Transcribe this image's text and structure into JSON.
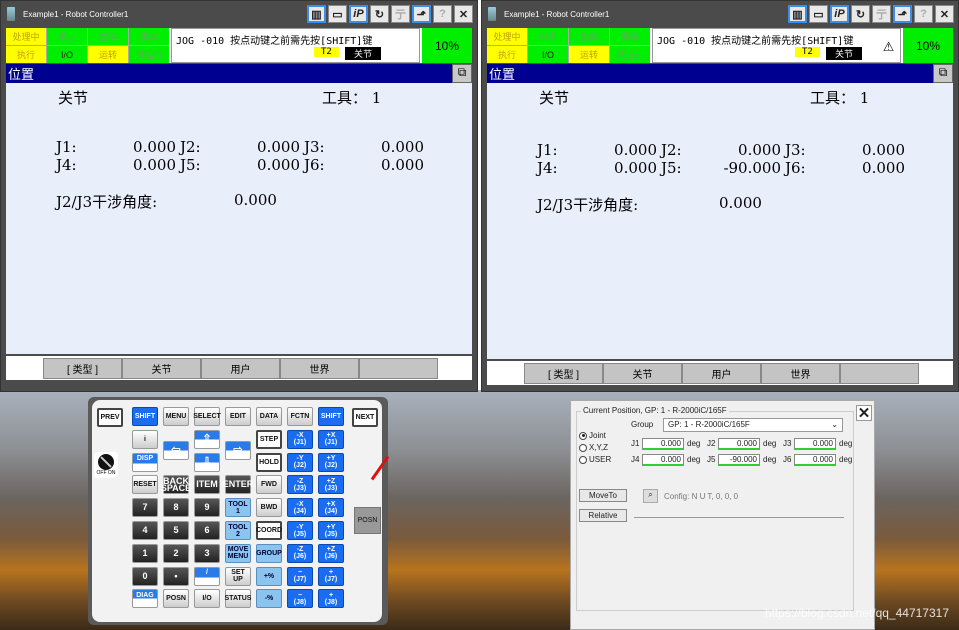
{
  "left": {
    "title": "Example1 - Robot Controller1",
    "toolbar_icons": [
      "trash-icon",
      "keyboard-icon",
      "ip-icon",
      "refresh-icon",
      "teach-icon",
      "export-icon",
      "help-icon",
      "close-icon"
    ],
    "leds": [
      "处理中",
      "单步",
      "暂停",
      "异常",
      "执行",
      "I/O",
      "运转",
      "试运行"
    ],
    "message": "JOG -010 按点动键之前需先按[SHIFT]键",
    "t2": "T2",
    "mode": "关节",
    "override": "10%",
    "screen_title": "位置",
    "coord_label": "关节",
    "tool_label": "工具： 1",
    "joints": [
      {
        "n": "J1:",
        "v": "0.000"
      },
      {
        "n": "J2:",
        "v": "0.000"
      },
      {
        "n": "J3:",
        "v": "0.000"
      },
      {
        "n": "J4:",
        "v": "0.000"
      },
      {
        "n": "J5:",
        "v": "0.000"
      },
      {
        "n": "J6:",
        "v": "0.000"
      }
    ],
    "interference_label": "J2/J3干涉角度:",
    "interference_value": "0.000",
    "function_keys": [
      "[ 类型 ]",
      "关节",
      "用户",
      "世界",
      ""
    ]
  },
  "right": {
    "title": "Example1 - Robot Controller1",
    "leds": [
      "处理中",
      "单步",
      "暂停",
      "异常",
      "执行",
      "I/O",
      "运转",
      "试运行"
    ],
    "message": "JOG -010 按点动键之前需先按[SHIFT]键",
    "t2": "T2",
    "mode": "关节",
    "override": "10%",
    "screen_title": "位置",
    "coord_label": "关节",
    "tool_label": "工具： 1",
    "joints": [
      {
        "n": "J1:",
        "v": "0.000"
      },
      {
        "n": "J2:",
        "v": "0.000"
      },
      {
        "n": "J3:",
        "v": "0.000"
      },
      {
        "n": "J4:",
        "v": "0.000"
      },
      {
        "n": "J5:",
        "v": "-90.000"
      },
      {
        "n": "J6:",
        "v": "0.000"
      }
    ],
    "interference_label": "J2/J3干涉角度:",
    "interference_value": "0.000",
    "function_keys": [
      "[ 类型 ]",
      "关节",
      "用户",
      "世界",
      ""
    ]
  },
  "keypad": {
    "prev": "PREV",
    "next": "NEXT",
    "side_posn": "POSN",
    "keyswitch": "OFF  ON",
    "rows": [
      [
        {
          "l": "SHIFT",
          "s": "blue"
        },
        {
          "l": "MENU",
          "s": "white"
        },
        {
          "l": "SELECT",
          "s": "white"
        },
        {
          "l": "EDIT",
          "s": "white"
        },
        {
          "l": "DATA",
          "s": "white"
        },
        {
          "l": "FCTN",
          "s": "white"
        },
        {
          "l": "SHIFT",
          "s": "blue"
        }
      ],
      [
        {
          "l": "i",
          "s": "white"
        },
        {
          "l": "⇦",
          "s": "arrow",
          "mid": true
        },
        {
          "l": "⇧",
          "s": "arrow"
        },
        {
          "l": "⇨",
          "s": "arrow",
          "mid": true
        },
        {
          "l": "STEP",
          "s": "boxed"
        },
        {
          "l": "-X\n(J1)",
          "s": "blue"
        },
        {
          "l": "+X\n(J1)",
          "s": "blue"
        }
      ],
      [
        {
          "l": "DISP\n▭▭",
          "s": "disp"
        },
        null,
        {
          "l": "⇩",
          "s": "arrow"
        },
        null,
        {
          "l": "HOLD",
          "s": "boxed"
        },
        {
          "l": "-Y\n(J2)",
          "s": "blue"
        },
        {
          "l": "+Y\n(J2)",
          "s": "blue"
        }
      ],
      [
        {
          "l": "RESET",
          "s": "white"
        },
        {
          "l": "BACK\nSPACE",
          "s": "dark"
        },
        {
          "l": "ITEM",
          "s": "dark"
        },
        {
          "l": "ENTER",
          "s": "dark"
        },
        {
          "l": "FWD",
          "s": "white"
        },
        {
          "l": "-Z\n(J3)",
          "s": "blue"
        },
        {
          "l": "+Z\n(J3)",
          "s": "blue"
        }
      ],
      [
        {
          "l": "7",
          "s": "dark"
        },
        {
          "l": "8",
          "s": "dark"
        },
        {
          "l": "9",
          "s": "dark"
        },
        {
          "l": "TOOL\n1",
          "s": "light"
        },
        {
          "l": "BWD",
          "s": "white"
        },
        {
          "l": "-X\n(J4)",
          "s": "blue"
        },
        {
          "l": "+X\n(J4)",
          "s": "blue"
        }
      ],
      [
        {
          "l": "4",
          "s": "dark"
        },
        {
          "l": "5",
          "s": "dark"
        },
        {
          "l": "6",
          "s": "dark"
        },
        {
          "l": "TOOL\n2",
          "s": "light"
        },
        {
          "l": "COORD",
          "s": "boxed"
        },
        {
          "l": "-Y\n(J5)",
          "s": "blue"
        },
        {
          "l": "+Y\n(J5)",
          "s": "blue"
        }
      ],
      [
        {
          "l": "1",
          "s": "dark"
        },
        {
          "l": "2",
          "s": "dark"
        },
        {
          "l": "3",
          "s": "dark"
        },
        {
          "l": "MOVE\nMENU",
          "s": "light"
        },
        {
          "l": "GROUP",
          "s": "light"
        },
        {
          "l": "-Z\n(J6)",
          "s": "blue"
        },
        {
          "l": "+Z\n(J6)",
          "s": "blue"
        }
      ],
      [
        {
          "l": "0",
          "s": "dark"
        },
        {
          "l": "•",
          "s": "dark"
        },
        {
          "l": "/\n—",
          "s": "disp"
        },
        {
          "l": "SET\nUP",
          "s": "white"
        },
        {
          "l": "+%",
          "s": "light"
        },
        {
          "l": "−\n(J7)",
          "s": "blue"
        },
        {
          "l": "+\n(J7)",
          "s": "blue"
        }
      ],
      [
        {
          "l": "DIAG\nHELP",
          "s": "diag"
        },
        {
          "l": "POSN",
          "s": "white"
        },
        {
          "l": "I/O",
          "s": "white"
        },
        {
          "l": "STATUS",
          "s": "white"
        },
        {
          "l": "-%",
          "s": "light"
        },
        {
          "l": "−\n(J8)",
          "s": "blue"
        },
        {
          "l": "+\n(J8)",
          "s": "blue"
        }
      ]
    ]
  },
  "dialog": {
    "title": "Current Position, GP: 1 - R-2000iC/165F",
    "group_label": "Group",
    "group_value": "GP: 1 - R-2000iC/165F",
    "modes": [
      {
        "label": "Joint",
        "selected": true
      },
      {
        "label": "X,Y,Z",
        "selected": false
      },
      {
        "label": "USER",
        "selected": false
      }
    ],
    "joints": [
      {
        "n": "J1",
        "v": "0.000"
      },
      {
        "n": "J2",
        "v": "0.000"
      },
      {
        "n": "J3",
        "v": "0.000"
      },
      {
        "n": "J4",
        "v": "0.000"
      },
      {
        "n": "J5",
        "v": "-90.000"
      },
      {
        "n": "J6",
        "v": "0.000"
      }
    ],
    "unit": "deg",
    "move_to": "MoveTo",
    "relative": "Relative",
    "config": "Config: N U T, 0, 0, 0"
  },
  "watermark": "https://blog.csdn.net/qq_44717317",
  "colors": {
    "led_yellow": "#ffff00",
    "led_green": "#00ee00",
    "header_blue": "#000090",
    "key_blue": "#1a6cf0"
  }
}
